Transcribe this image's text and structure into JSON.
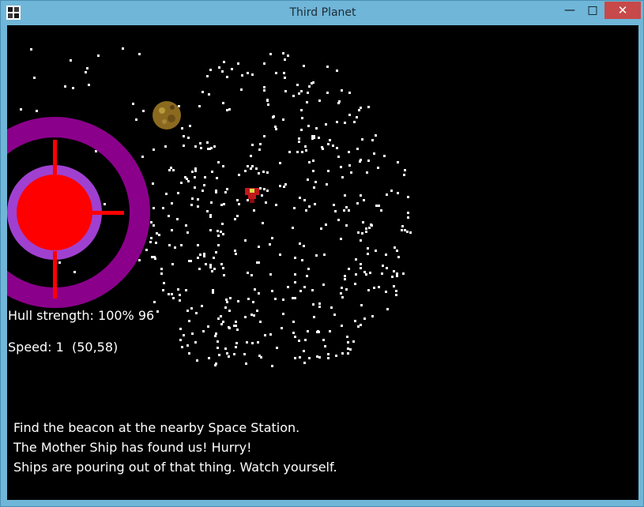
{
  "window": {
    "title": "Third Planet",
    "icons": {
      "app": "app-window-icon",
      "minimize": "minimize-icon",
      "maximize": "maximize-icon",
      "close": "close-icon"
    },
    "glyphs": {
      "minimize": "—",
      "maximize": "□",
      "close": "✕"
    }
  },
  "hud": {
    "hull_label": "Hull strength: 100% 96",
    "speed_label": "Speed: 1  (50,58)"
  },
  "messages": [
    "Find the beacon at the nearby Space Station.",
    "The Mother Ship has found us! Hurry!",
    "Ships are pouring out of that thing. Watch yourself."
  ],
  "colors": {
    "space": "#000000",
    "star": "#ffffff",
    "station_ring": "#8b008b",
    "station_inner_ring": "#a040d0",
    "station_core": "#ff0000",
    "asteroid": "#8b6a20",
    "player_ship": "#c0181b"
  }
}
